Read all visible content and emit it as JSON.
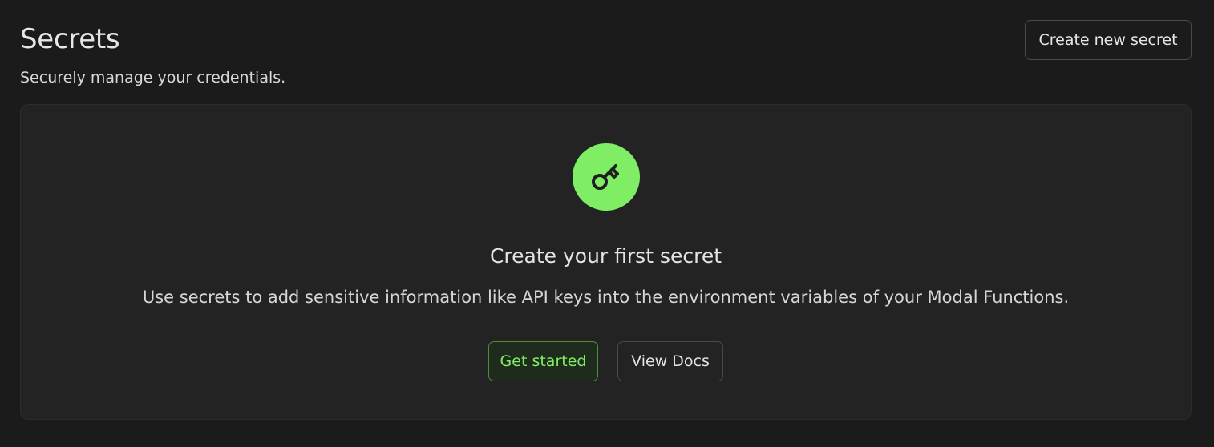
{
  "header": {
    "title": "Secrets",
    "subtitle": "Securely manage your credentials.",
    "create_button_label": "Create new secret"
  },
  "empty_state": {
    "icon": "key-icon",
    "title": "Create your first secret",
    "description": "Use secrets to add sensitive information like API keys into the environment variables of your Modal Functions.",
    "primary_button_label": "Get started",
    "secondary_button_label": "View Docs"
  },
  "colors": {
    "background": "#1b1b1b",
    "card_background": "#232323",
    "accent": "#7fee64"
  }
}
